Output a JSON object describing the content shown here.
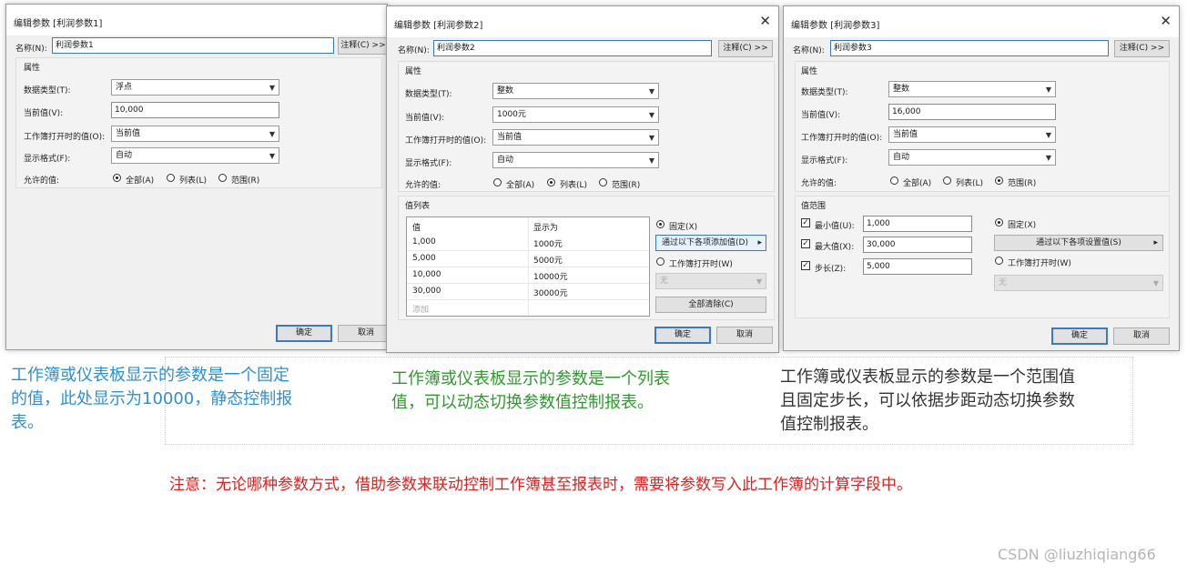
{
  "dialog1": {
    "title": "编辑参数 [利润参数1]",
    "name_label": "名称(N):",
    "name_value": "利润参数1",
    "comment_button": "注释(C) >>",
    "properties_label": "属性",
    "datatype_label": "数据类型(T):",
    "datatype_value": "浮点",
    "current_label": "当前值(V):",
    "current_value": "10,000",
    "open_label": "工作簿打开时的值(O):",
    "open_value": "当前值",
    "format_label": "显示格式(F):",
    "format_value": "自动",
    "allowed_label": "允许的值:",
    "radio_all": "全部(A)",
    "radio_list": "列表(L)",
    "radio_range": "范围(R)",
    "ok": "确定",
    "cancel": "取消"
  },
  "dialog2": {
    "title": "编辑参数 [利润参数2]",
    "name_label": "名称(N):",
    "name_value": "利润参数2",
    "comment_button": "注释(C) >>",
    "properties_label": "属性",
    "datatype_label": "数据类型(T):",
    "datatype_value": "整数",
    "current_label": "当前值(V):",
    "current_value": "1000元",
    "open_label": "工作簿打开时的值(O):",
    "open_value": "当前值",
    "format_label": "显示格式(F):",
    "format_value": "自动",
    "allowed_label": "允许的值:",
    "radio_all": "全部(A)",
    "radio_list": "列表(L)",
    "radio_range": "范围(R)",
    "list_group_label": "值列表",
    "list_headers": [
      "值",
      "显示为"
    ],
    "list_rows": [
      [
        "1,000",
        "1000元"
      ],
      [
        "5,000",
        "5000元"
      ],
      [
        "10,000",
        "10000元"
      ],
      [
        "30,000",
        "30000元"
      ]
    ],
    "list_add": "添加",
    "fixed_label": "固定(X)",
    "add_from_button": "通过以下各项添加值(D)",
    "on_open_label": "工作簿打开时(W)",
    "none_value": "无",
    "clear_all_button": "全部清除(C)",
    "ok": "确定",
    "cancel": "取消"
  },
  "dialog3": {
    "title": "编辑参数 [利润参数3]",
    "name_label": "名称(N):",
    "name_value": "利润参数3",
    "comment_button": "注释(C) >>",
    "properties_label": "属性",
    "datatype_label": "数据类型(T):",
    "datatype_value": "整数",
    "current_label": "当前值(V):",
    "current_value": "16,000",
    "open_label": "工作簿打开时的值(O):",
    "open_value": "当前值",
    "format_label": "显示格式(F):",
    "format_value": "自动",
    "allowed_label": "允许的值:",
    "radio_all": "全部(A)",
    "radio_list": "列表(L)",
    "radio_range": "范围(R)",
    "range_group_label": "值范围",
    "min_label": "最小值(U):",
    "min_value": "1,000",
    "max_label": "最大值(X):",
    "max_value": "30,000",
    "step_label": "步长(Z):",
    "step_value": "5,000",
    "fixed_label": "固定(X)",
    "set_from_button": "通过以下各项设置值(S)",
    "on_open_label": "工作簿打开时(W)",
    "none_value": "无",
    "ok": "确定",
    "cancel": "取消"
  },
  "captions": {
    "c1": "工作簿或仪表板显示的参数是一个固定的值，此处显示为10000，静态控制报表。",
    "c2": "工作簿或仪表板显示的参数是一个列表值，可以动态切换参数值控制报表。",
    "c3": "工作簿或仪表板显示的参数是一个范围值且固定步长，可以依据步距动态切换参数值控制报表。"
  },
  "note": "注意：无论哪种参数方式，借助参数来联动控制工作簿甚至报表时，需要将参数写入此工作簿的计算字段中。",
  "watermark": "CSDN @liuzhiqiang66",
  "colors": {
    "caption1": "#2f8fd6",
    "caption2": "#2e9a2e",
    "caption3": "#333333",
    "note": "#e0201e"
  }
}
